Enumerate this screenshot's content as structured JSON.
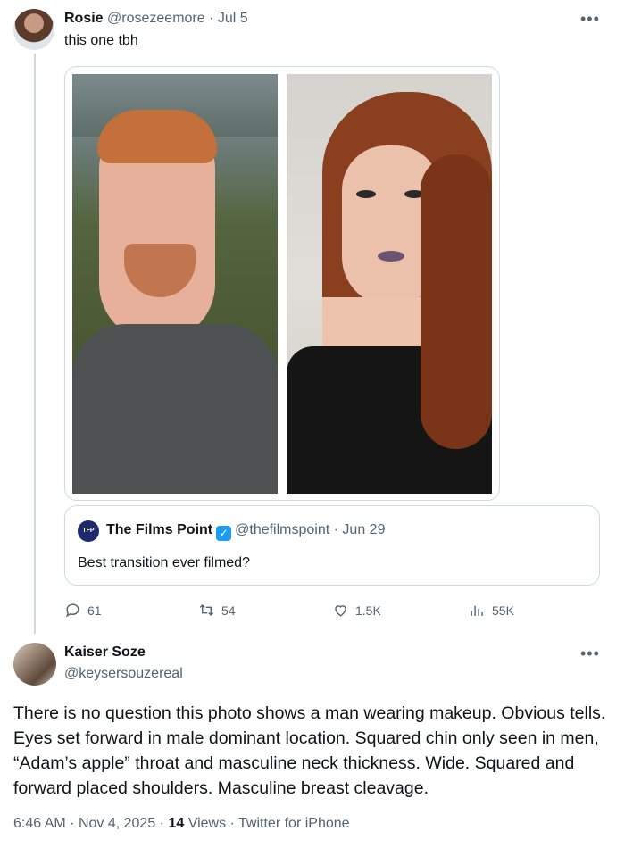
{
  "tweet": {
    "author_name": "Rosie",
    "author_handle": "@rosezeemore",
    "separator": "·",
    "date": "Jul 5",
    "text": "this one tbh",
    "more_icon": "more-horizontal-icon",
    "quoted": {
      "logo_text": "TFP",
      "name": "The Films Point",
      "handle": "@thefilmspoint",
      "date": "Jun 29",
      "text": "Best transition ever filmed?"
    },
    "actions": {
      "replies": "61",
      "retweets": "54",
      "likes": "1.5K",
      "views": "55K"
    }
  },
  "reply": {
    "author_name": "Kaiser Soze",
    "author_handle": "@keysersouzereal",
    "text": "There is no question this photo shows a man wearing makeup. Obvious tells. Eyes set forward in male dominant location. Squared chin only seen in men, “Adam’s apple” throat and masculine neck thickness. Wide. Squared and forward placed shoulders. Masculine breast cleavage.",
    "meta": {
      "time": "6:46 AM",
      "date": "Nov 4, 2025",
      "views_count": "14",
      "views_label": "Views",
      "source": "Twitter for iPhone"
    }
  },
  "colors": {
    "secondary_text": "#536471",
    "border": "#cfd9de",
    "verified": "#1d9bf0"
  }
}
